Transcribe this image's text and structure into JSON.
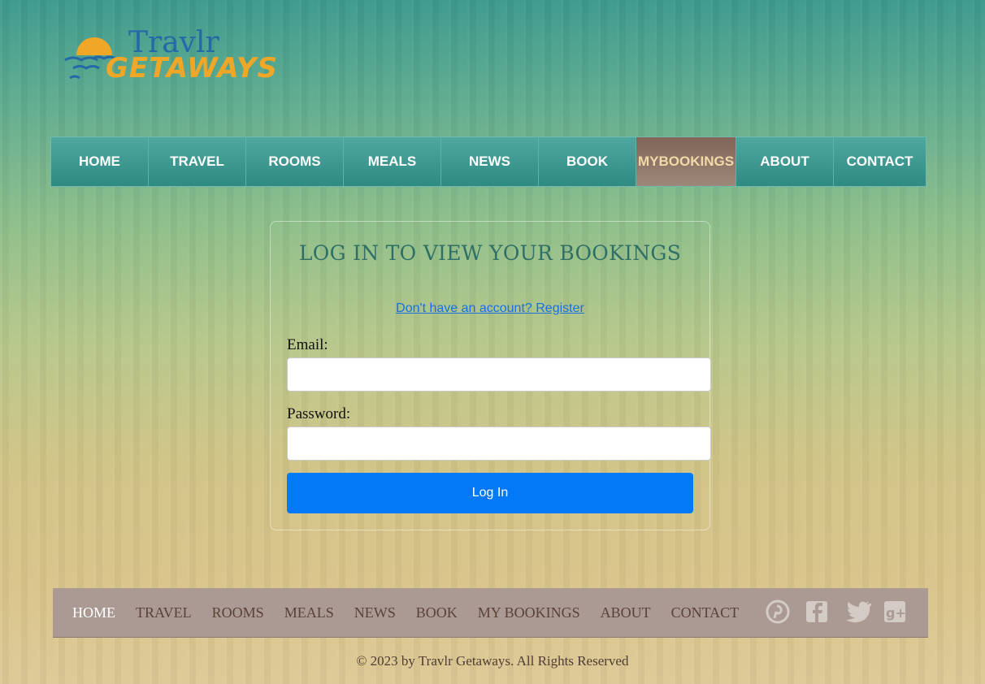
{
  "brand": {
    "line1": "Travlr",
    "line2": "GETAWAYS",
    "colors": {
      "sun": "#f0a626",
      "blue": "#2468a8"
    }
  },
  "nav": {
    "items": [
      {
        "label": "HOME"
      },
      {
        "label": "TRAVEL"
      },
      {
        "label": "ROOMS"
      },
      {
        "label": "MEALS"
      },
      {
        "label": "NEWS"
      },
      {
        "label": "BOOK"
      },
      {
        "label": "MYBOOKINGS",
        "active": true
      },
      {
        "label": "ABOUT"
      },
      {
        "label": "CONTACT"
      }
    ],
    "colors": {
      "bar": "#3a958d",
      "active": "#8e7668",
      "active_text": "#f1d9a8"
    }
  },
  "login": {
    "title": "LOG IN TO VIEW YOUR BOOKINGS",
    "register_link": "Don't have an account? Register",
    "email_label": "Email:",
    "email_value": "",
    "password_label": "Password:",
    "password_value": "",
    "submit_label": "Log In",
    "colors": {
      "button": "#0479f7",
      "link": "#1670e6"
    }
  },
  "footer": {
    "links": [
      {
        "label": "HOME",
        "active": true
      },
      {
        "label": "TRAVEL"
      },
      {
        "label": "ROOMS"
      },
      {
        "label": "MEALS"
      },
      {
        "label": "NEWS"
      },
      {
        "label": "BOOK"
      },
      {
        "label": "MY BOOKINGS"
      },
      {
        "label": "ABOUT"
      },
      {
        "label": "CONTACT"
      }
    ],
    "social_icons": [
      "pinterest-icon",
      "facebook-icon",
      "twitter-icon",
      "google-plus-icon"
    ],
    "copyright": "© 2023 by Travlr Getaways. All Rights Reserved"
  }
}
